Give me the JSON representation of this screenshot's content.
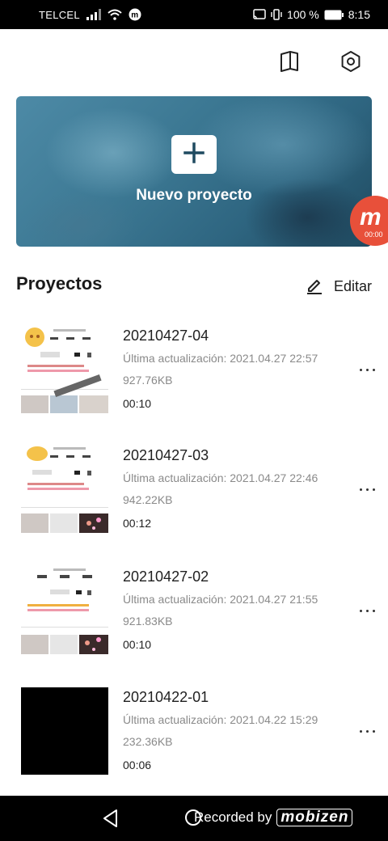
{
  "status_bar": {
    "carrier": "TELCEL",
    "battery": "100 %",
    "time": "8:15"
  },
  "toolbar": {
    "guide_icon": "book-icon",
    "settings_icon": "gear-icon"
  },
  "hero": {
    "label": "Nuevo proyecto",
    "icon": "plus-icon"
  },
  "recorder_badge": {
    "letter": "m",
    "time": "00:00",
    "color": "#e8503a"
  },
  "projects_section": {
    "title": "Proyectos",
    "edit_label": "Editar"
  },
  "projects": [
    {
      "name": "20210427-04",
      "updated": "Última actualización: 2021.04.27 22:57",
      "size": "927.76KB",
      "duration": "00:10"
    },
    {
      "name": "20210427-03",
      "updated": "Última actualización: 2021.04.27 22:46",
      "size": "942.22KB",
      "duration": "00:12"
    },
    {
      "name": "20210427-02",
      "updated": "Última actualización: 2021.04.27 21:55",
      "size": "921.83KB",
      "duration": "00:10"
    },
    {
      "name": "20210422-01",
      "updated": "Última actualización: 2021.04.22 15:29",
      "size": "232.36KB",
      "duration": "00:06"
    }
  ],
  "nav_bar": {
    "watermark_prefix": "Recorded by",
    "watermark_brand": "mobizen"
  },
  "colors": {
    "accent": "#1f4a60",
    "text": "#1a1a1a",
    "muted": "#8a8a8a"
  }
}
